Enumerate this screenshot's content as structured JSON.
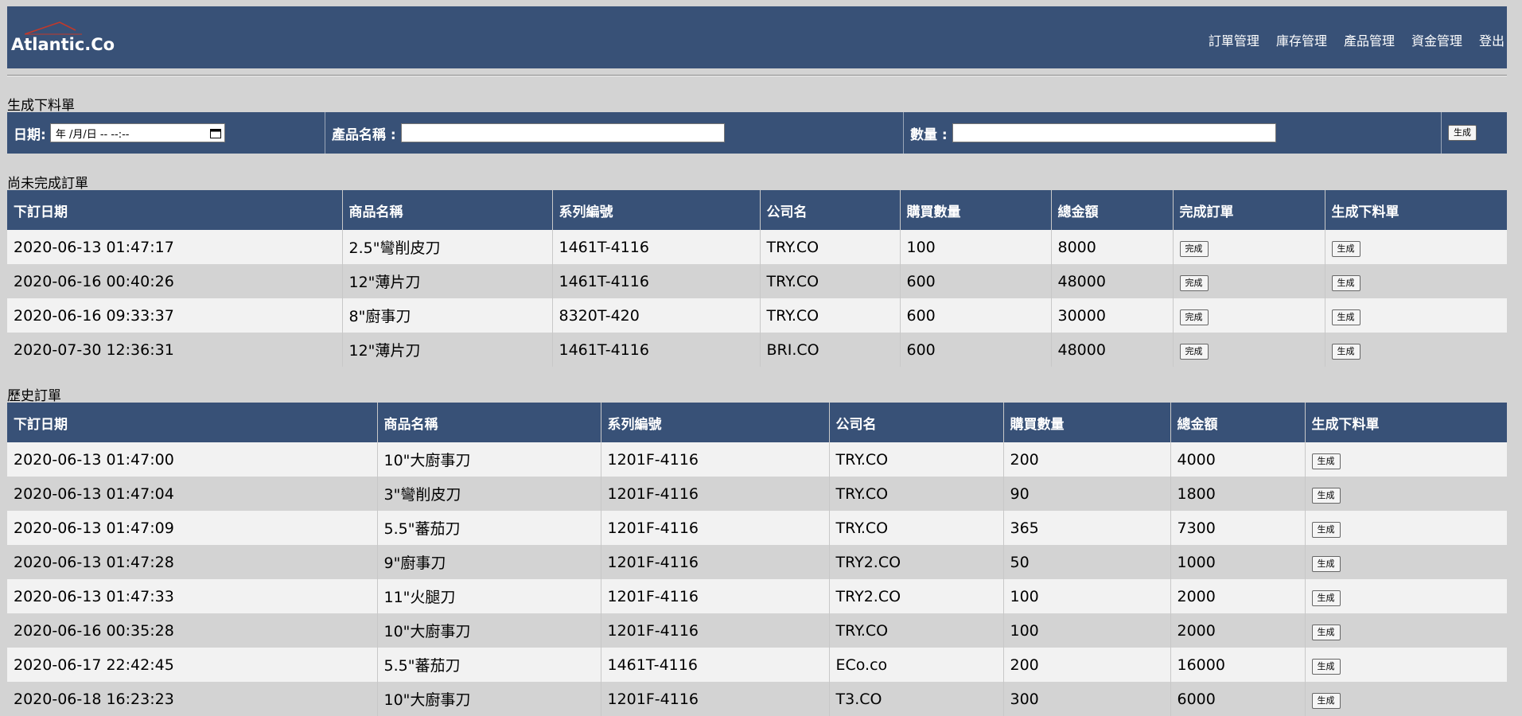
{
  "brand": {
    "name": "Atlantic.Co"
  },
  "nav": [
    "訂單管理",
    "庫存管理",
    "產品管理",
    "資金管理",
    "登出"
  ],
  "create_form": {
    "title": "生成下料單",
    "date_label": "日期:",
    "date_placeholder": "年 /月/日 -- --:--",
    "product_label": "產品名稱 :",
    "product_value": "",
    "qty_label": "數量 :",
    "qty_value": "",
    "submit_label": "生成"
  },
  "pending": {
    "title": "尚未完成訂單",
    "headers": [
      "下訂日期",
      "商品名稱",
      "系列編號",
      "公司名",
      "購買數量",
      "總金額",
      "完成訂單",
      "生成下料單"
    ],
    "complete_label": "完成",
    "generate_label": "生成",
    "rows": [
      [
        "2020-06-13 01:47:17",
        "2.5\"彎削皮刀",
        "1461T-4116",
        "TRY.CO",
        "100",
        "8000"
      ],
      [
        "2020-06-16 00:40:26",
        "12\"薄片刀",
        "1461T-4116",
        "TRY.CO",
        "600",
        "48000"
      ],
      [
        "2020-06-16 09:33:37",
        "8\"廚事刀",
        "8320T-420",
        "TRY.CO",
        "600",
        "30000"
      ],
      [
        "2020-07-30 12:36:31",
        "12\"薄片刀",
        "1461T-4116",
        "BRI.CO",
        "600",
        "48000"
      ]
    ]
  },
  "history": {
    "title": "歷史訂單",
    "headers": [
      "下訂日期",
      "商品名稱",
      "系列編號",
      "公司名",
      "購買數量",
      "總金額",
      "生成下料單"
    ],
    "generate_label": "生成",
    "rows": [
      [
        "2020-06-13 01:47:00",
        "10\"大廚事刀",
        "1201F-4116",
        "TRY.CO",
        "200",
        "4000"
      ],
      [
        "2020-06-13 01:47:04",
        "3\"彎削皮刀",
        "1201F-4116",
        "TRY.CO",
        "90",
        "1800"
      ],
      [
        "2020-06-13 01:47:09",
        "5.5\"蕃茄刀",
        "1201F-4116",
        "TRY.CO",
        "365",
        "7300"
      ],
      [
        "2020-06-13 01:47:28",
        "9\"廚事刀",
        "1201F-4116",
        "TRY2.CO",
        "50",
        "1000"
      ],
      [
        "2020-06-13 01:47:33",
        "11\"火腿刀",
        "1201F-4116",
        "TRY2.CO",
        "100",
        "2000"
      ],
      [
        "2020-06-16 00:35:28",
        "10\"大廚事刀",
        "1201F-4116",
        "TRY.CO",
        "100",
        "2000"
      ],
      [
        "2020-06-17 22:42:45",
        "5.5\"蕃茄刀",
        "1461T-4116",
        "ECo.co",
        "200",
        "16000"
      ],
      [
        "2020-06-18 16:23:23",
        "10\"大廚事刀",
        "1201F-4116",
        "T3.CO",
        "300",
        "6000"
      ]
    ]
  },
  "colors": {
    "header": "#385177",
    "background": "#d3d3d3",
    "row_light": "#f2f2f2"
  }
}
